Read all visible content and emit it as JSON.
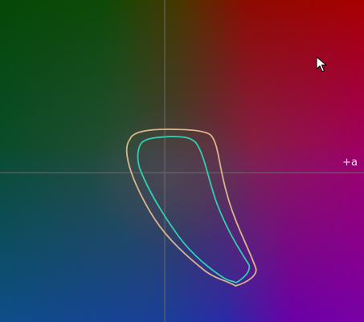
{
  "view": {
    "axis_label_a": "+a"
  },
  "colors": {
    "outer_gamut": "#d9b58a",
    "inner_gamut": "#2ed0b0",
    "axis_line": "#6a6a6a",
    "corner_top_left": "#074a07",
    "corner_top_right": "#a80000",
    "corner_bottom_left": "#0f4a8f",
    "corner_bottom_right": "#7a00a8"
  },
  "icons": {
    "cursor": "mouse-pointer-icon"
  }
}
